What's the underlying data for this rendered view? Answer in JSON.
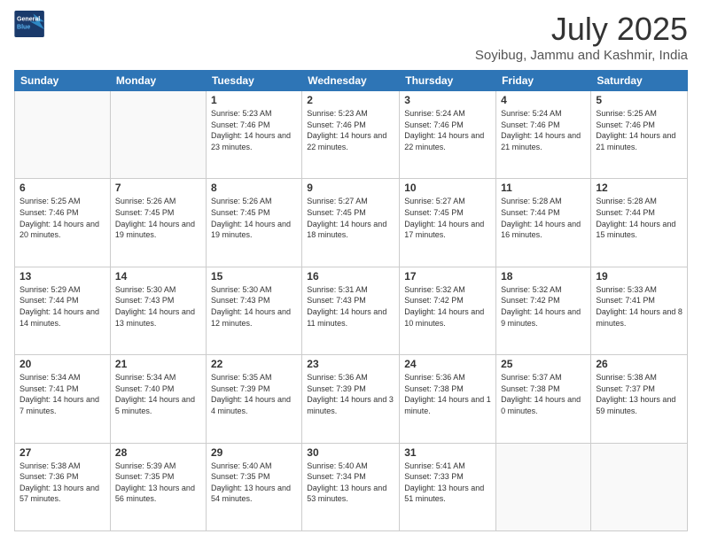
{
  "header": {
    "logo_line1": "General",
    "logo_line2": "Blue",
    "month": "July 2025",
    "location": "Soyibug, Jammu and Kashmir, India"
  },
  "days_of_week": [
    "Sunday",
    "Monday",
    "Tuesday",
    "Wednesday",
    "Thursday",
    "Friday",
    "Saturday"
  ],
  "weeks": [
    [
      {
        "day": "",
        "info": ""
      },
      {
        "day": "",
        "info": ""
      },
      {
        "day": "1",
        "info": "Sunrise: 5:23 AM\nSunset: 7:46 PM\nDaylight: 14 hours and 23 minutes."
      },
      {
        "day": "2",
        "info": "Sunrise: 5:23 AM\nSunset: 7:46 PM\nDaylight: 14 hours and 22 minutes."
      },
      {
        "day": "3",
        "info": "Sunrise: 5:24 AM\nSunset: 7:46 PM\nDaylight: 14 hours and 22 minutes."
      },
      {
        "day": "4",
        "info": "Sunrise: 5:24 AM\nSunset: 7:46 PM\nDaylight: 14 hours and 21 minutes."
      },
      {
        "day": "5",
        "info": "Sunrise: 5:25 AM\nSunset: 7:46 PM\nDaylight: 14 hours and 21 minutes."
      }
    ],
    [
      {
        "day": "6",
        "info": "Sunrise: 5:25 AM\nSunset: 7:46 PM\nDaylight: 14 hours and 20 minutes."
      },
      {
        "day": "7",
        "info": "Sunrise: 5:26 AM\nSunset: 7:45 PM\nDaylight: 14 hours and 19 minutes."
      },
      {
        "day": "8",
        "info": "Sunrise: 5:26 AM\nSunset: 7:45 PM\nDaylight: 14 hours and 19 minutes."
      },
      {
        "day": "9",
        "info": "Sunrise: 5:27 AM\nSunset: 7:45 PM\nDaylight: 14 hours and 18 minutes."
      },
      {
        "day": "10",
        "info": "Sunrise: 5:27 AM\nSunset: 7:45 PM\nDaylight: 14 hours and 17 minutes."
      },
      {
        "day": "11",
        "info": "Sunrise: 5:28 AM\nSunset: 7:44 PM\nDaylight: 14 hours and 16 minutes."
      },
      {
        "day": "12",
        "info": "Sunrise: 5:28 AM\nSunset: 7:44 PM\nDaylight: 14 hours and 15 minutes."
      }
    ],
    [
      {
        "day": "13",
        "info": "Sunrise: 5:29 AM\nSunset: 7:44 PM\nDaylight: 14 hours and 14 minutes."
      },
      {
        "day": "14",
        "info": "Sunrise: 5:30 AM\nSunset: 7:43 PM\nDaylight: 14 hours and 13 minutes."
      },
      {
        "day": "15",
        "info": "Sunrise: 5:30 AM\nSunset: 7:43 PM\nDaylight: 14 hours and 12 minutes."
      },
      {
        "day": "16",
        "info": "Sunrise: 5:31 AM\nSunset: 7:43 PM\nDaylight: 14 hours and 11 minutes."
      },
      {
        "day": "17",
        "info": "Sunrise: 5:32 AM\nSunset: 7:42 PM\nDaylight: 14 hours and 10 minutes."
      },
      {
        "day": "18",
        "info": "Sunrise: 5:32 AM\nSunset: 7:42 PM\nDaylight: 14 hours and 9 minutes."
      },
      {
        "day": "19",
        "info": "Sunrise: 5:33 AM\nSunset: 7:41 PM\nDaylight: 14 hours and 8 minutes."
      }
    ],
    [
      {
        "day": "20",
        "info": "Sunrise: 5:34 AM\nSunset: 7:41 PM\nDaylight: 14 hours and 7 minutes."
      },
      {
        "day": "21",
        "info": "Sunrise: 5:34 AM\nSunset: 7:40 PM\nDaylight: 14 hours and 5 minutes."
      },
      {
        "day": "22",
        "info": "Sunrise: 5:35 AM\nSunset: 7:39 PM\nDaylight: 14 hours and 4 minutes."
      },
      {
        "day": "23",
        "info": "Sunrise: 5:36 AM\nSunset: 7:39 PM\nDaylight: 14 hours and 3 minutes."
      },
      {
        "day": "24",
        "info": "Sunrise: 5:36 AM\nSunset: 7:38 PM\nDaylight: 14 hours and 1 minute."
      },
      {
        "day": "25",
        "info": "Sunrise: 5:37 AM\nSunset: 7:38 PM\nDaylight: 14 hours and 0 minutes."
      },
      {
        "day": "26",
        "info": "Sunrise: 5:38 AM\nSunset: 7:37 PM\nDaylight: 13 hours and 59 minutes."
      }
    ],
    [
      {
        "day": "27",
        "info": "Sunrise: 5:38 AM\nSunset: 7:36 PM\nDaylight: 13 hours and 57 minutes."
      },
      {
        "day": "28",
        "info": "Sunrise: 5:39 AM\nSunset: 7:35 PM\nDaylight: 13 hours and 56 minutes."
      },
      {
        "day": "29",
        "info": "Sunrise: 5:40 AM\nSunset: 7:35 PM\nDaylight: 13 hours and 54 minutes."
      },
      {
        "day": "30",
        "info": "Sunrise: 5:40 AM\nSunset: 7:34 PM\nDaylight: 13 hours and 53 minutes."
      },
      {
        "day": "31",
        "info": "Sunrise: 5:41 AM\nSunset: 7:33 PM\nDaylight: 13 hours and 51 minutes."
      },
      {
        "day": "",
        "info": ""
      },
      {
        "day": "",
        "info": ""
      }
    ]
  ]
}
